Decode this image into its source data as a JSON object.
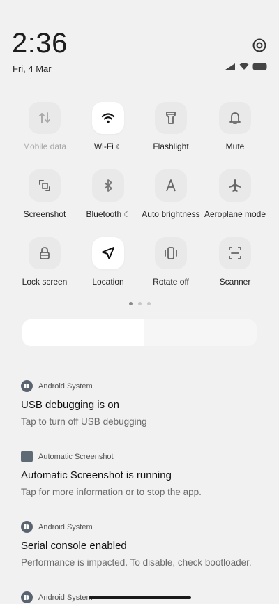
{
  "status": {
    "time": "2:36",
    "date": "Fri, 4 Mar",
    "icons": [
      "signal-icon",
      "wifi-icon",
      "battery-icon"
    ]
  },
  "tiles": [
    {
      "label": "Mobile data",
      "icon": "mobile-data-icon",
      "active": false,
      "dim": true
    },
    {
      "label": "Wi-Fi",
      "icon": "wifi-icon",
      "active": true,
      "dim": false
    },
    {
      "label": "Flashlight",
      "icon": "flashlight-icon",
      "active": false,
      "dim": false
    },
    {
      "label": "Mute",
      "icon": "bell-icon",
      "active": false,
      "dim": false
    },
    {
      "label": "Screenshot",
      "icon": "screenshot-icon",
      "active": false,
      "dim": false
    },
    {
      "label": "Bluetooth",
      "icon": "bluetooth-icon",
      "active": false,
      "dim": false
    },
    {
      "label": "Auto brightness",
      "icon": "auto-brightness-icon",
      "active": false,
      "dim": false
    },
    {
      "label": "Aeroplane mode",
      "icon": "aeroplane-icon",
      "active": false,
      "dim": false
    },
    {
      "label": "Lock screen",
      "icon": "lock-icon",
      "active": false,
      "dim": false
    },
    {
      "label": "Location",
      "icon": "location-icon",
      "active": true,
      "dim": false
    },
    {
      "label": "Rotate off",
      "icon": "rotate-icon",
      "active": false,
      "dim": false
    },
    {
      "label": "Scanner",
      "icon": "scanner-icon",
      "active": false,
      "dim": false
    }
  ],
  "pager": {
    "pages": 3,
    "current": 1
  },
  "brightness": {
    "level": 0.52
  },
  "notifications": [
    {
      "app": "Android System",
      "title": "USB debugging is on",
      "body": "Tap to turn off USB debugging"
    },
    {
      "app": "Automatic Screenshot",
      "title": "Automatic Screenshot is running",
      "body": "Tap for more information or to stop the app."
    },
    {
      "app": "Android System",
      "title": "Serial console enabled",
      "body": "Performance is impacted. To disable, check bootloader."
    },
    {
      "app": "Android System",
      "title": "",
      "body": ""
    }
  ]
}
